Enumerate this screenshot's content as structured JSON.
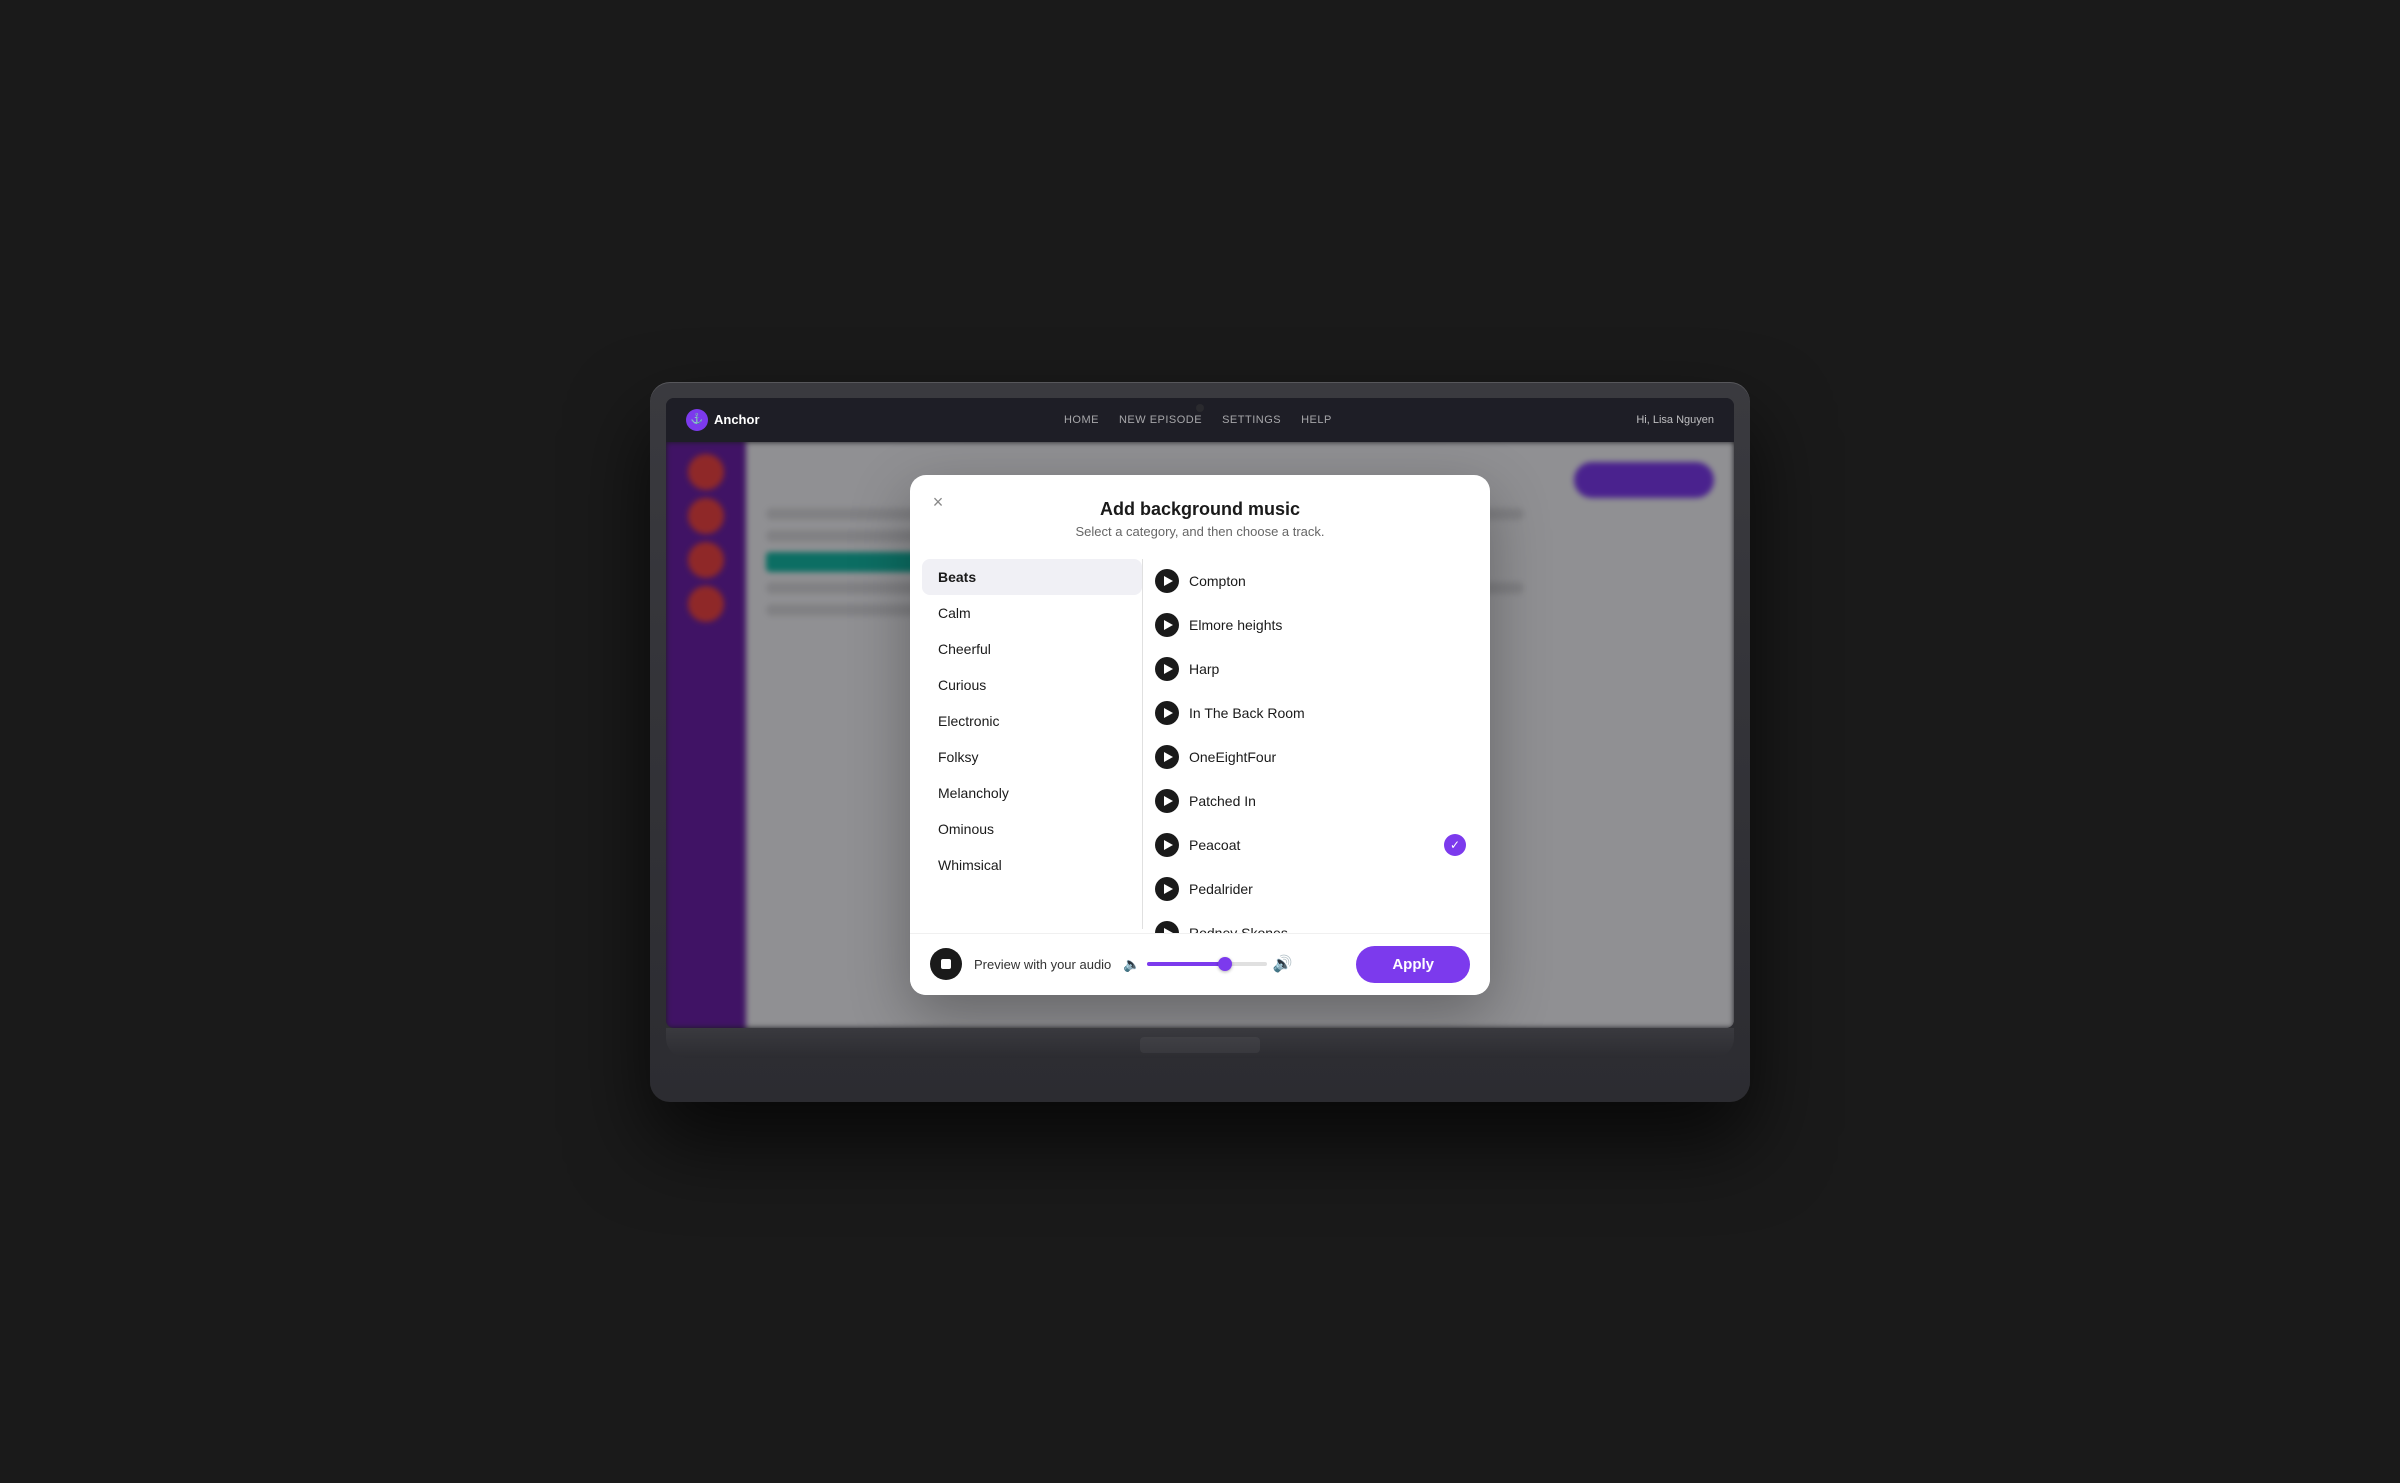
{
  "modal": {
    "title": "Add background music",
    "subtitle": "Select a category, and then choose a track.",
    "close_label": "×"
  },
  "categories": [
    {
      "id": "beats",
      "label": "Beats",
      "active": true
    },
    {
      "id": "calm",
      "label": "Calm",
      "active": false
    },
    {
      "id": "cheerful",
      "label": "Cheerful",
      "active": false
    },
    {
      "id": "curious",
      "label": "Curious",
      "active": false
    },
    {
      "id": "electronic",
      "label": "Electronic",
      "active": false
    },
    {
      "id": "folksy",
      "label": "Folksy",
      "active": false
    },
    {
      "id": "melancholy",
      "label": "Melancholy",
      "active": false
    },
    {
      "id": "ominous",
      "label": "Ominous",
      "active": false
    },
    {
      "id": "whimsical",
      "label": "Whimsical",
      "active": false
    }
  ],
  "tracks": [
    {
      "id": "compton",
      "label": "Compton",
      "selected": false
    },
    {
      "id": "elmore-heights",
      "label": "Elmore heights",
      "selected": false
    },
    {
      "id": "harp",
      "label": "Harp",
      "selected": false
    },
    {
      "id": "in-the-back-room",
      "label": "In The Back Room",
      "selected": false
    },
    {
      "id": "oneeightfour",
      "label": "OneEightFour",
      "selected": false
    },
    {
      "id": "patched-in",
      "label": "Patched In",
      "selected": false
    },
    {
      "id": "peacoat",
      "label": "Peacoat",
      "selected": true
    },
    {
      "id": "pedalrider",
      "label": "Pedalrider",
      "selected": false
    },
    {
      "id": "rodney-skones",
      "label": "Rodney Skones",
      "selected": false
    }
  ],
  "footer": {
    "preview_label": "Preview with your audio",
    "apply_label": "Apply",
    "volume_percent": 65
  },
  "nav": {
    "logo": "Anchor",
    "items": [
      "HOME",
      "NEW EPISODE",
      "SETTINGS",
      "HELP"
    ],
    "user": "Hi, Lisa Nguyen"
  }
}
